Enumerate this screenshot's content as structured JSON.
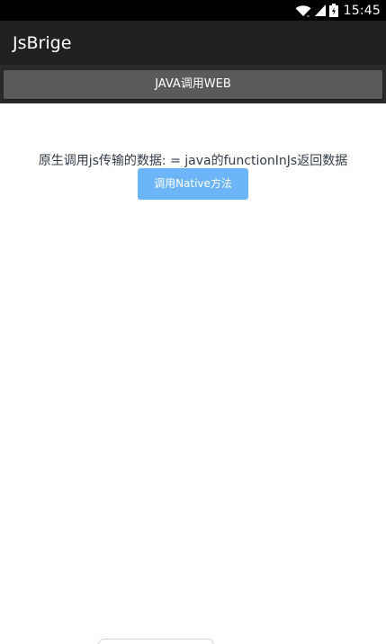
{
  "status_bar": {
    "time": "15:45",
    "icons": [
      "wifi-icon",
      "signal-icon",
      "battery-icon"
    ]
  },
  "app_bar": {
    "title": "JsBrige"
  },
  "toolbar": {
    "java_web_button_label": "JAVA调用WEB"
  },
  "webview": {
    "result_text": "原生调用js传输的数据: = java的functionInJs返回数据",
    "native_button_label": "调用Native方法"
  },
  "colors": {
    "status_bar_bg": "#000000",
    "app_bar_bg": "#212121",
    "toolbar_button_bg": "#5a5a5a",
    "native_button_bg": "#6bb5f8",
    "content_bg": "#ffffff"
  }
}
